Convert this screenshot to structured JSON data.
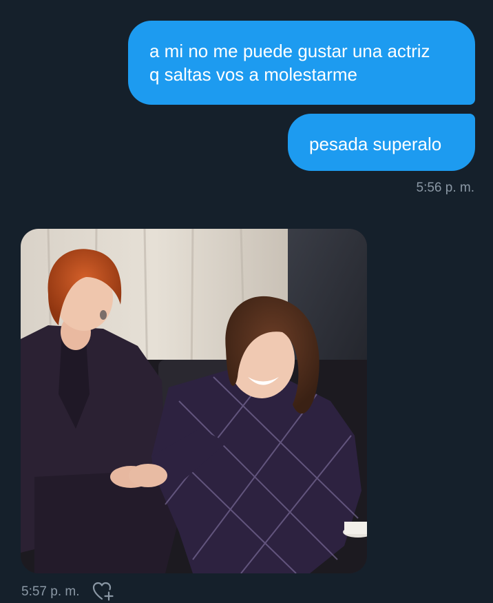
{
  "messages": [
    {
      "direction": "sent",
      "lines": [
        "a mi no me puede gustar una actriz",
        "q saltas vos a molestarme"
      ]
    },
    {
      "direction": "sent",
      "text": "pesada superalo",
      "timestamp": "5:56 p. m."
    },
    {
      "direction": "received",
      "type": "image",
      "timestamp": "5:57 p. m.",
      "reaction_icon": "heart-plus-icon"
    }
  ],
  "colors": {
    "background": "#15202b",
    "bubble": "#1d9bf0",
    "bubble_text": "#ffffff",
    "timestamp": "#8b98a5"
  }
}
